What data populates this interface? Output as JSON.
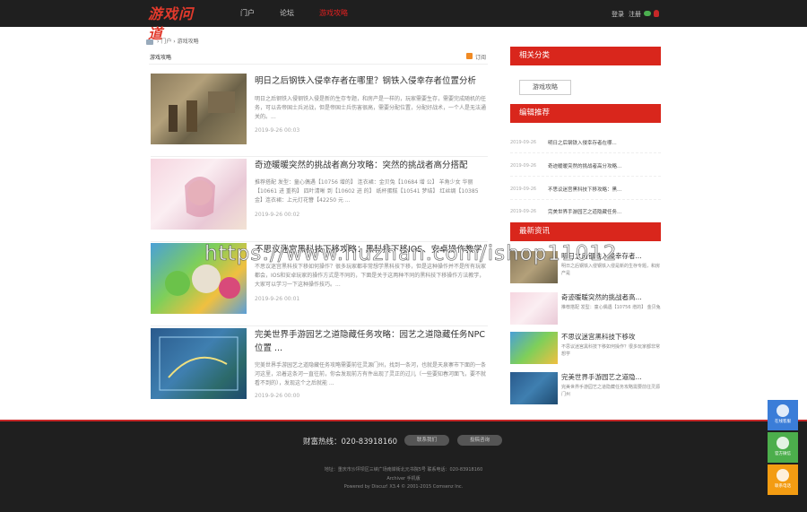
{
  "header": {
    "logo_text": "游戏问道",
    "nav": [
      {
        "label": "门户",
        "active": false
      },
      {
        "label": "论坛",
        "active": false
      },
      {
        "label": "游戏攻略",
        "active": true
      }
    ],
    "login": "登录",
    "register": "注册"
  },
  "breadcrumb": {
    "item1": "门户",
    "item2": "游戏攻略",
    "sep": "›"
  },
  "list": {
    "title": "游戏攻略",
    "rss": "订阅"
  },
  "articles": [
    {
      "title": "明日之后钢铁入侵幸存者在哪里？钢铁入侵幸存者位置分析",
      "summary": "明日之后钢铁入侵钢铁入侵是新的生存专题，和房产是一样的，玩家需要生存，需要完成随机的任务，可以去帝国士兵对战，但是帝国士兵伤害很高，需要分配位置，分配好战术，一个人是无法通关的。...",
      "date": "2019-9-26 00:03"
    },
    {
      "title": "奇迹暖暖突然的挑战者高分攻略：突然的挑战者高分搭配",
      "summary": "推荐搭配 发型：童心偶遇【10756 增的】 连衣裙：金贝兔【10684 增 公】 羊角少女 华丽【10661 进 重构】 四叶清晰 到【10602 进 的】 纸杯蛋糕【10541 梦结】 红丝绸【10385 金】连衣裙：上元灯花簪【42250 元 ...",
      "date": "2019-9-26 00:02"
    },
    {
      "title": "不思议迷宫黑科技下移攻略：黑科技下移IOS、安卓操作教学",
      "summary": "不思议迷宫黑科技下移如何操作？很多玩家都非常想学黑科技下移，但是这种操作并不是所有玩家都会，IOS和安卓玩家的操作方式是不同的，下面是关于这两种不同的黑科技下移操作方法教学，大家可以学习一下这种操作技巧。...",
      "date": "2019-9-26 00:01"
    },
    {
      "title": "完美世界手游园艺之道隐藏任务攻略：园艺之道隐藏任务NPC位置 ...",
      "summary": "完美世界手游园艺之道隐藏任务攻略需要前往灵源门州，找到一条河，也就是天泉寨市下面的一条河这里，沿着这条河一直往前，你会发现前方有件出现了灵正的过儿（一些要知春河面飞，要不就看不到的），发现这个之后就能 ...",
      "date": "2019-9-26 00:00"
    }
  ],
  "sidebar": {
    "categories_title": "相关分类",
    "category_button": "游戏攻略",
    "recommend_title": "编辑推荐",
    "recommend": [
      {
        "date": "2019-09-26",
        "title": "明日之后钢铁入侵幸存者在哪..."
      },
      {
        "date": "2019-09-26",
        "title": "奇迹暖暖突然的挑战者高分攻略..."
      },
      {
        "date": "2019-09-26",
        "title": "不思议迷宫黑科技下移攻略：黑..."
      },
      {
        "date": "2019-09-26",
        "title": "完美世界手游园艺之道隐藏任务..."
      }
    ],
    "latest_title": "最新资讯",
    "latest": [
      {
        "title": "明日之后钢铁入侵幸存者...",
        "summary": "明日之后钢铁入侵钢铁入侵是新的生存专题，和房产是"
      },
      {
        "title": "奇迹暖暖突然的挑战者高...",
        "summary": "推荐搭配 发型：童心偶遇【10756 增的】 金贝兔"
      },
      {
        "title": "不思议迷宫黑科技下移攻",
        "summary": "不思议迷宫黑科技下移如何操作？很多玩家都非常想学"
      },
      {
        "title": "完美世界手游园艺之道隐...",
        "summary": "完美世界手游园艺之道隐藏任务攻略需要前往灵源门州"
      }
    ]
  },
  "footer": {
    "hotline": "财富热线：020-83918160",
    "btn1": "联系我们",
    "btn2": "投稿咨询",
    "address": "地址：重庆市沙坪坝区三峡广场南岸街北元书院5号   联系电话：020-83918160",
    "links": "Archiver   手机版",
    "powered": "Powered by Discuz! X3.4  © 2001-2015 Comsenz Inc."
  },
  "float": [
    {
      "label": "在线客服",
      "color": "#3b7dd8"
    },
    {
      "label": "官方微信",
      "color": "#4cae4c"
    },
    {
      "label": "联系电话",
      "color": "#f39c12"
    }
  ],
  "watermark": "https://www.huzhan.com/ishop11012"
}
